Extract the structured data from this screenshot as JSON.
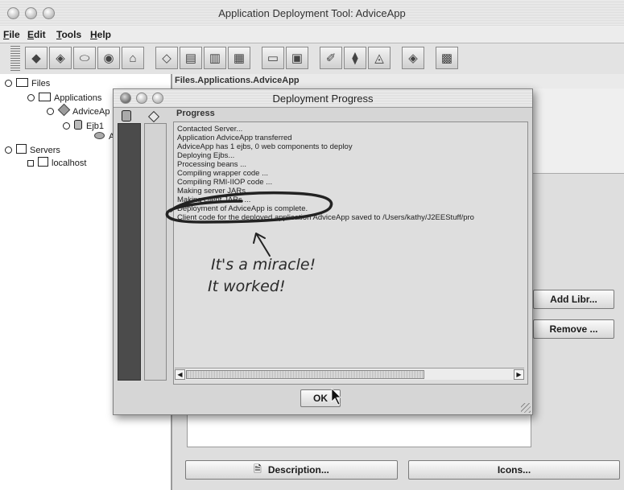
{
  "window": {
    "title": "Application Deployment Tool: AdviceApp"
  },
  "menu": [
    "File",
    "Edit",
    "Tools",
    "Help"
  ],
  "toolbar": {
    "buttons": [
      "new-application-icon",
      "new-ejb-icon",
      "new-web-component-icon",
      "new-server-icon",
      "new-package-icon",
      "add-icon",
      "ejb-wizard-icon",
      "web-wizard-icon",
      "app-client-icon",
      "open-icon",
      "save-icon",
      "verify-icon",
      "deploy-icon",
      "undeploy-icon",
      "check-icon",
      "report-icon"
    ]
  },
  "tree": {
    "files": "Files",
    "applications": "Applications",
    "app": "AdviceAp",
    "ejb": "Ejb1",
    "ejb_child": "A",
    "servers": "Servers",
    "localhost": "localhost"
  },
  "right": {
    "path": "Files.Applications.AdviceApp",
    "add_lib": "Add Libr...",
    "remove": "Remove ...",
    "description": "Description...",
    "icons": "Icons..."
  },
  "dialog": {
    "title": "Deployment Progress",
    "progress_label": "Progress",
    "log": [
      "Contacted Server...",
      "Application AdviceApp transferred",
      "AdviceApp has 1  ejbs, 0 web components to deploy",
      "Deploying Ejbs...",
      "Processing beans ...",
      "Compiling wrapper code ...",
      "Compiling RMI-IIOP code ...",
      "Making server JARs ...",
      "Making client JARs ...",
      "Deployment of AdviceApp is complete.",
      "Client code for the deployed application AdviceApp saved to /Users/kathy/J2EEStuff/pro"
    ],
    "ok": "OK"
  },
  "annotation": {
    "line1": "It's a miracle!",
    "line2": "It worked!"
  }
}
